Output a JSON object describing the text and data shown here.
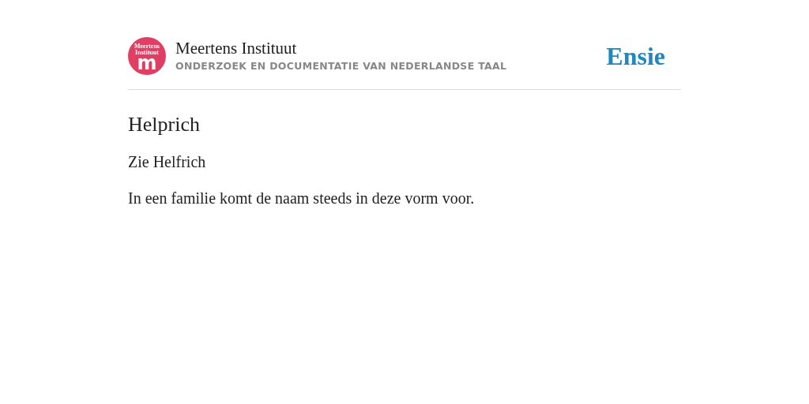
{
  "logo": {
    "lines": [
      "Meertens",
      "Instituut"
    ],
    "letter": "m"
  },
  "header": {
    "title": "Meertens Instituut",
    "subtitle": "ONDERZOEK EN DOCUMENTATIE VAN NEDERLANDSE TAAL",
    "brand": "Ensie"
  },
  "entry": {
    "title": "Helprich",
    "paragraphs": [
      "Zie Helfrich",
      "In een familie komt de naam steeds in deze vorm voor."
    ]
  }
}
